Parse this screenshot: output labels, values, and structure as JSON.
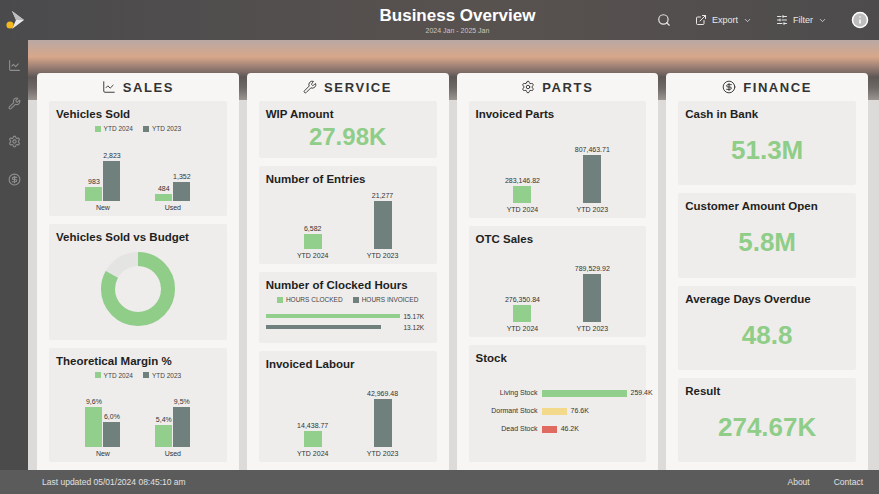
{
  "header": {
    "title": "Business Overview",
    "subtitle": "2024 Jan - 2025 Jan",
    "actions": [
      {
        "label": "Export"
      },
      {
        "label": "Filter"
      }
    ]
  },
  "sections": [
    {
      "title": "SALES",
      "cards": [
        {
          "kind": "grouped",
          "title": "Vehicles Sold",
          "legend": [
            {
              "label": "YTD 2024",
              "color": "#93cf8c"
            },
            {
              "label": "YTD 2023",
              "color": "#6f807d"
            }
          ],
          "categories": [
            "New",
            "Used"
          ],
          "series": [
            {
              "values": [
                983,
                484
              ],
              "labels": [
                "983",
                "484"
              ]
            },
            {
              "values": [
                2823,
                1352
              ],
              "labels": [
                "2,823",
                "1,352"
              ]
            }
          ]
        },
        {
          "kind": "donut",
          "title": "Vehicles Sold vs Budget",
          "level": 0.83
        },
        {
          "kind": "grouped",
          "title": "Theoretical Margin %",
          "legend": [
            {
              "label": "YTD 2024",
              "color": "#93cf8c"
            },
            {
              "label": "YTD 2023",
              "color": "#6f807d"
            }
          ],
          "categories": [
            "New",
            "Used"
          ],
          "series": [
            {
              "values": [
                9.6,
                5.4
              ],
              "labels": [
                "9,6%",
                "5,4%"
              ]
            },
            {
              "values": [
                6.0,
                9.5
              ],
              "labels": [
                "6,0%",
                "9,5%"
              ]
            }
          ]
        }
      ]
    },
    {
      "title": "SERVICE",
      "cards": [
        {
          "kind": "kpi",
          "title": "WIP Amount",
          "value": "27.98K"
        },
        {
          "kind": "pair",
          "title": "Number of Entries",
          "bars": [
            {
              "label": "YTD 2024",
              "value": 6582,
              "reading": "6,582",
              "color": "#93cf8c"
            },
            {
              "label": "YTD 2023",
              "value": 21277,
              "reading": "21,277",
              "color": "#6f807d"
            }
          ]
        },
        {
          "kind": "lines",
          "title": "Number of Clocked Hours",
          "legend": [
            {
              "label": "HOURS CLOCKED",
              "color": "#93cf8c"
            },
            {
              "label": "HOURS INVOICED",
              "color": "#6f807d"
            }
          ],
          "values": [
            15170,
            13120
          ],
          "labels": [
            "15.17K",
            "13.12K"
          ]
        },
        {
          "kind": "pair",
          "title": "Invoiced Labour",
          "bars": [
            {
              "label": "YTD 2024",
              "value": 14438.77,
              "reading": "14,438.77",
              "color": "#93cf8c"
            },
            {
              "label": "YTD 2023",
              "value": 42969.48,
              "reading": "42,969.48",
              "color": "#6f807d"
            }
          ]
        }
      ]
    },
    {
      "title": "PARTS",
      "cards": [
        {
          "kind": "pair",
          "title": "Invoiced Parts",
          "bars": [
            {
              "label": "YTD 2024",
              "value": 283146.82,
              "reading": "283,146.82",
              "color": "#93cf8c"
            },
            {
              "label": "YTD 2023",
              "value": 807463.71,
              "reading": "807,463.71",
              "color": "#6f807d"
            }
          ]
        },
        {
          "kind": "pair",
          "title": "OTC Sales",
          "bars": [
            {
              "label": "YTD 2024",
              "value": 276350.84,
              "reading": "276,350.84",
              "color": "#93cf8c"
            },
            {
              "label": "YTD 2023",
              "value": 789529.92,
              "reading": "789,529.92",
              "color": "#6f807d"
            }
          ]
        },
        {
          "kind": "stock",
          "title": "Stock",
          "items": [
            {
              "label": "Living Stock",
              "value": 259.4,
              "reading": "259.4K",
              "color": "#93cf8c"
            },
            {
              "label": "Dormant Stock",
              "value": 76.6,
              "reading": "76.6K",
              "color": "#f3d98b"
            },
            {
              "label": "Dead Stock",
              "value": 46.2,
              "reading": "46.2K",
              "color": "#e06a5f"
            }
          ]
        }
      ]
    },
    {
      "title": "FINANCE",
      "cards": [
        {
          "kind": "kpi",
          "title": "Cash in Bank",
          "value": "51.3M"
        },
        {
          "kind": "kpi",
          "title": "Customer Amount Open",
          "value": "5.8M"
        },
        {
          "kind": "kpi",
          "title": "Average Days Overdue",
          "value": "48.8"
        },
        {
          "kind": "kpi",
          "title": "Result",
          "value": "274.67K"
        }
      ]
    }
  ],
  "footer": {
    "updated": "Last updated 05/01/2024 08:45:10 am",
    "links": [
      "About",
      "Contact"
    ]
  }
}
